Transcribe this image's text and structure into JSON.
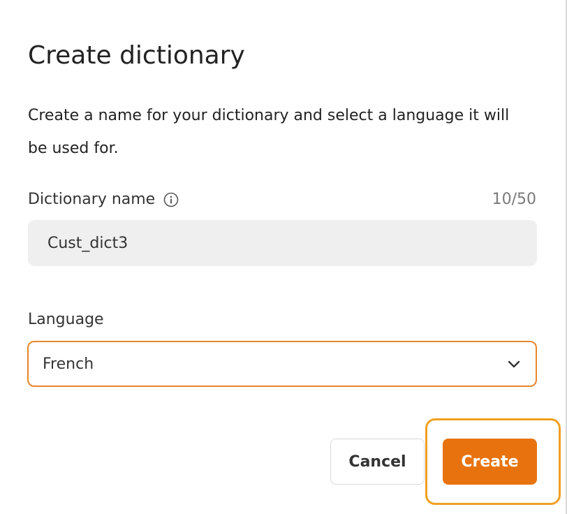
{
  "dialog": {
    "title": "Create dictionary",
    "description": "Create a name for your dictionary and select a language it will be used for."
  },
  "name_field": {
    "label": "Dictionary name",
    "counter": "10/50",
    "value": "Cust_dict3",
    "info_icon": "info-circle-icon"
  },
  "language_field": {
    "label": "Language",
    "selected": "French",
    "dropdown_icon": "chevron-down-icon"
  },
  "actions": {
    "cancel_label": "Cancel",
    "create_label": "Create"
  },
  "colors": {
    "accent": "#e8730e",
    "select_border": "#e8862a",
    "focus_highlight": "#f0a020",
    "input_background": "#efefef"
  }
}
